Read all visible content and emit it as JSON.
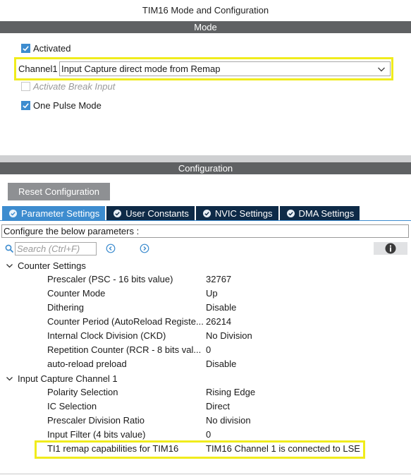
{
  "window": {
    "title": "TIM16 Mode and Configuration"
  },
  "mode": {
    "header": "Mode",
    "activated_label": "Activated",
    "activated_checked": true,
    "channel_label": "Channel1",
    "channel_value": "Input Capture direct mode from Remap",
    "break_label": "Activate Break Input",
    "break_checked": false,
    "one_pulse_label": "One Pulse Mode",
    "one_pulse_checked": true
  },
  "config": {
    "header": "Configuration",
    "reset_label": "Reset Configuration",
    "tabs": [
      {
        "label": "Parameter Settings",
        "active": true
      },
      {
        "label": "User Constants",
        "active": false
      },
      {
        "label": "NVIC Settings",
        "active": false
      },
      {
        "label": "DMA Settings",
        "active": false
      }
    ],
    "hint": "Configure the below parameters :",
    "search_placeholder": "Search (Ctrl+F)",
    "groups": [
      {
        "title": "Counter Settings",
        "params": [
          {
            "name": "Prescaler (PSC - 16 bits value)",
            "value": "32767"
          },
          {
            "name": "Counter Mode",
            "value": "Up"
          },
          {
            "name": "Dithering",
            "value": "Disable"
          },
          {
            "name": "Counter Period (AutoReload Registe...",
            "value": "26214"
          },
          {
            "name": "Internal Clock Division (CKD)",
            "value": "No Division"
          },
          {
            "name": "Repetition Counter (RCR - 8 bits val...",
            "value": "0"
          },
          {
            "name": "auto-reload preload",
            "value": "Disable"
          }
        ]
      },
      {
        "title": "Input Capture Channel 1",
        "params": [
          {
            "name": "Polarity Selection",
            "value": "Rising Edge"
          },
          {
            "name": "IC Selection",
            "value": "Direct"
          },
          {
            "name": "Prescaler Division Ratio",
            "value": "No division"
          },
          {
            "name": "Input Filter (4 bits value)",
            "value": "0"
          },
          {
            "name": "TI1 remap capabilities for TIM16",
            "value": "TIM16 Channel 1 is connected to LSE"
          }
        ]
      }
    ]
  },
  "colors": {
    "accent": "#3d8ccf",
    "tab_dark": "#0e2a47",
    "section_bar": "#5f6163",
    "highlight": "#f0ec1c"
  }
}
